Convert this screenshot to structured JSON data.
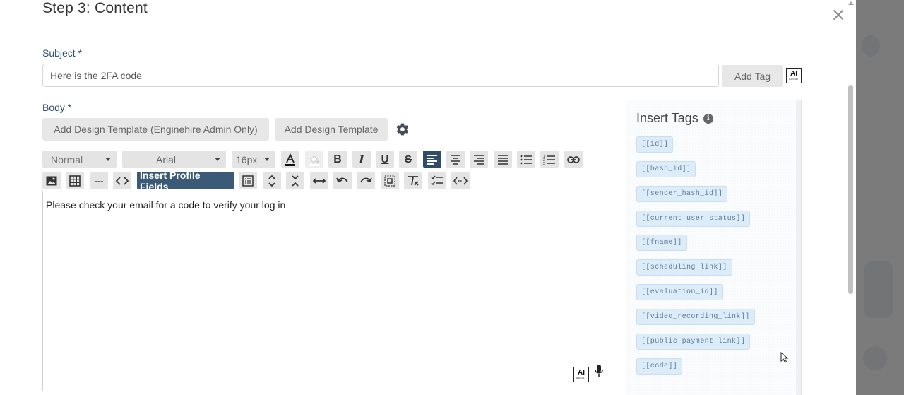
{
  "modal": {
    "title": "Step 3: Content"
  },
  "subject": {
    "label": "Subject *",
    "value": "Here is the 2FA code",
    "add_tag_label": "Add Tag"
  },
  "ai_assist": {
    "line1": "AI",
    "line2": "ASSIST"
  },
  "body": {
    "label": "Body *",
    "template_admin_label": "Add Design Template (Enginehire Admin Only)",
    "template_label": "Add Design Template",
    "content": "Please check your email for a code to verify your log in"
  },
  "toolbar": {
    "format_value": "Normal",
    "font_value": "Arial",
    "size_value": "16px",
    "bold": "B",
    "italic": "I",
    "underline": "U",
    "strike": "S",
    "divider": "---",
    "code": "<>",
    "insert_profile_fields": "Insert Profile Fields"
  },
  "tags_panel": {
    "title": "Insert Tags",
    "info": "i",
    "tags": [
      "[[id]]",
      "[[hash_id]]",
      "[[sender_hash_id]]",
      "[[current_user_status]]",
      "[[fname]]",
      "[[scheduling_link]]",
      "[[evaluation_id]]",
      "[[video_recording_link]]",
      "[[public_payment_link]]",
      "[[code]]"
    ]
  },
  "colors": {
    "accent": "#2f4d68",
    "label": "#2c4f6e",
    "tag_bg": "#dcecf9",
    "tag_text": "#5b7d9a"
  }
}
